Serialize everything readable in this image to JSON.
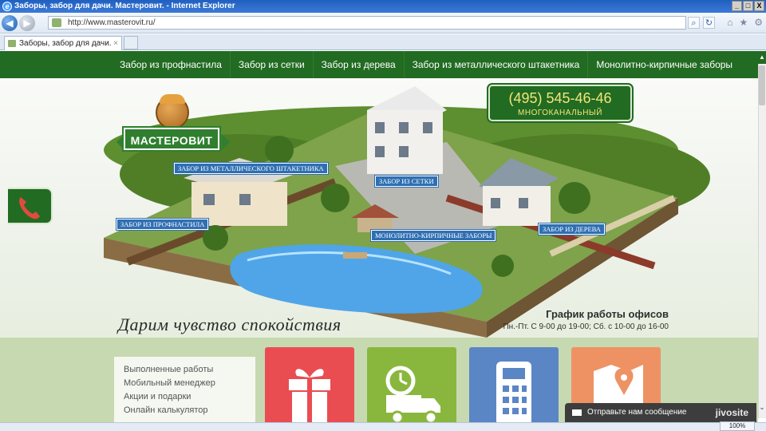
{
  "window": {
    "title": "Заборы, забор для дачи. Мастеровит. - Internet Explorer",
    "controls": [
      "_",
      "□",
      "X"
    ]
  },
  "browser": {
    "address": "http://www.masterovit.ru/",
    "tab_title": "Заборы, забор для дачи. М...",
    "tab_close": "×",
    "search_glyph": "⌕",
    "refresh_glyph": "↻",
    "home_glyph": "⌂",
    "favorites_glyph": "★",
    "settings_glyph": "⚙",
    "zoom": "100%",
    "back_glyph": "◀",
    "forward_glyph": "▶"
  },
  "site_nav": {
    "items": [
      "Забор из профнастила",
      "Забор из сетки",
      "Забор из дерева",
      "Забор из металлического штакетника",
      "Монолитно-кирпичные заборы"
    ]
  },
  "phone": {
    "number": "(495) 545-46-46",
    "subtitle": "МНОГОКАНАЛЬНЫЙ"
  },
  "logo": {
    "text": "МАСТЕРОВИТ"
  },
  "hero_tags": {
    "metal": "ЗАБОР ИЗ МЕТАЛЛИЧЕСКОГО ШТАКЕТНИКА",
    "mesh": "ЗАБОР ИЗ СЕТКИ",
    "profnastil": "ЗАБОР ИЗ ПРОФНАСТИЛА",
    "brick": "МОНОЛИТНО-КИРПИЧНЫЕ ЗАБОРЫ",
    "wood": "ЗАБОР ИЗ ДЕРЕВА"
  },
  "slogan": "Дарим чувство спокойствия",
  "hours": {
    "title": "График работы офисов",
    "text": "Пн.-Пт. С 9-00 до 19-00; Сб. с 10-00 до 16-00"
  },
  "side_menu": [
    "Выполненные работы",
    "Мобильный менеджер",
    "Акции и подарки",
    "Онлайн калькулятор"
  ],
  "tiles": [
    {
      "icon": "gift-icon",
      "color": "#e94d52"
    },
    {
      "icon": "delivery-truck-icon",
      "color": "#89b73d"
    },
    {
      "icon": "calculator-icon",
      "color": "#5a86c6"
    },
    {
      "icon": "map-pin-icon",
      "color": "#ee9264"
    }
  ],
  "chat": {
    "label": "Отправьте нам сообщение",
    "brand": "jivosite"
  },
  "colors": {
    "brand_green": "#226b22",
    "phone_text": "#f3e57a",
    "tag_blue": "#2f6fb2"
  }
}
